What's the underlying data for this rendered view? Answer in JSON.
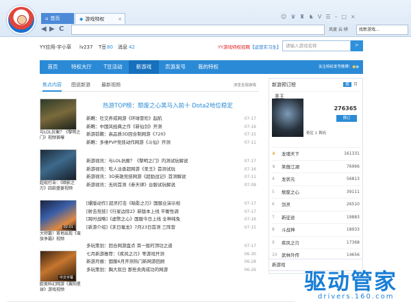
{
  "browser": {
    "tab_home": "首页",
    "tab_active": "游戏特权",
    "search_placeholder": "找新游戏...",
    "tools_label": "风度 云·辨",
    "nav_back": "◀",
    "nav_forward": "▶",
    "nav_refresh": "C"
  },
  "user": {
    "name": "YY应用-宇小草",
    "level": "lv237",
    "tdou_label": "T豆",
    "tdou": "80",
    "msg_label": "消息",
    "msg": "42"
  },
  "recruit": {
    "text": "YY游戏特权招聘",
    "link": "【运营实习生】"
  },
  "game_search_placeholder": "请输入游戏名称",
  "mainnav": {
    "items": [
      "首页",
      "特权大厅",
      "T豆活动",
      "新游戏",
      "页游发号",
      "我的特权"
    ],
    "follow": "关注特权发号微博："
  },
  "subtabs": {
    "items": [
      "焦点内容",
      "图说新游",
      "最新视频"
    ],
    "more": "浏览全部游戏"
  },
  "thumbs": [
    {
      "tag": "",
      "caption": "与LOL抗衡？《黎明之门》视频首曝"
    },
    {
      "tag": "",
      "caption": "超现打击：《暗影之刃》四款盛宴视频"
    },
    {
      "tag": "02:01",
      "caption": "大师篇！首地出现《蛮族争霸》视频"
    },
    {
      "tag": "中文字幕",
      "caption": "欧美科幻网游《翼阳星球》游戏视频"
    }
  ],
  "hot": "热游TOP榜：颓废之心黑马入前十 Dota2地位稳定",
  "news_groups": [
    [
      {
        "t": "新瞧：社交养成网游《环球冒险》起航",
        "d": "07-17"
      },
      {
        "t": "新瞧：中国风经典之作《新仙剑》开测",
        "d": "07-16"
      },
      {
        "t": "新游前瞻：高品质3D回合制网游《720》",
        "d": "07-15"
      },
      {
        "t": "新瞧：多维PVP竞技动作网游《斗仙》开测",
        "d": "07-11"
      }
    ],
    [
      {
        "t": "新游视讯：与LOL抗衡？《黎明之门》内测试玩解说",
        "d": "07-17"
      },
      {
        "t": "新游视讯：吃人淡香超网游《圣王》首测试玩",
        "d": "07-16"
      },
      {
        "t": "新游视讯：3D英雄竞技网游《超励战记》首测解说",
        "d": "07-11"
      },
      {
        "t": "新游视讯：无码首测《参天律》台服试玩解说",
        "d": "07-09"
      }
    ],
    [
      {
        "t": "[爆版动作] 超灵打击《暗影之刃》国服业演示视",
        "d": "07-17"
      },
      {
        "t": "[射击竞技]《行星边际2》新版本上线 平衡性调",
        "d": "07-17"
      },
      {
        "t": "[跨时战略]《虚默之心》国服今日上线 全神纯免",
        "d": "07-16"
      },
      {
        "t": "[新游介绍]《末日毫龙》7月23日首测 三阵营",
        "d": "07-15"
      }
    ],
    [
      {
        "t": "多玩策划：回合网游盘点 耳一般的顶功之道",
        "d": "07-17"
      },
      {
        "t": "七月新游推荐：《疾风之刃》等游戏开测",
        "d": "06-30"
      },
      {
        "t": "新游月报：国服6月开测热门新网游回顾",
        "d": "06-28"
      },
      {
        "t": "多玩策划：胸大就日 那些卖肉成功的网游",
        "d": "06-26"
      }
    ]
  ],
  "sidebar": {
    "title": "新游预订榜",
    "tab_a": "周",
    "tab_b": "月",
    "feature": {
      "name": "圣王",
      "votes": "276365",
      "button": "预订",
      "info": "奇区 1 首码"
    },
    "rank": [
      {
        "n": "",
        "name": "龙魂天下",
        "v": "161331"
      },
      {
        "n": "",
        "name": "笑傲江湖",
        "v": "76966"
      },
      {
        "n": "4",
        "name": "龙状元",
        "v": "56813"
      },
      {
        "n": "5",
        "name": "颓废之心",
        "v": "39111"
      },
      {
        "n": "6",
        "name": "剑灵",
        "v": "26510"
      },
      {
        "n": "7",
        "name": "新征途",
        "v": "19883"
      },
      {
        "n": "8",
        "name": "斗战神",
        "v": "18933"
      },
      {
        "n": "9",
        "name": "疾风之刃",
        "v": "17368"
      },
      {
        "n": "10",
        "name": "武林外传",
        "v": "14656"
      }
    ],
    "more": "新游戏"
  },
  "watermark": {
    "big": "驱动管家",
    "small": "drivers.160.com"
  }
}
